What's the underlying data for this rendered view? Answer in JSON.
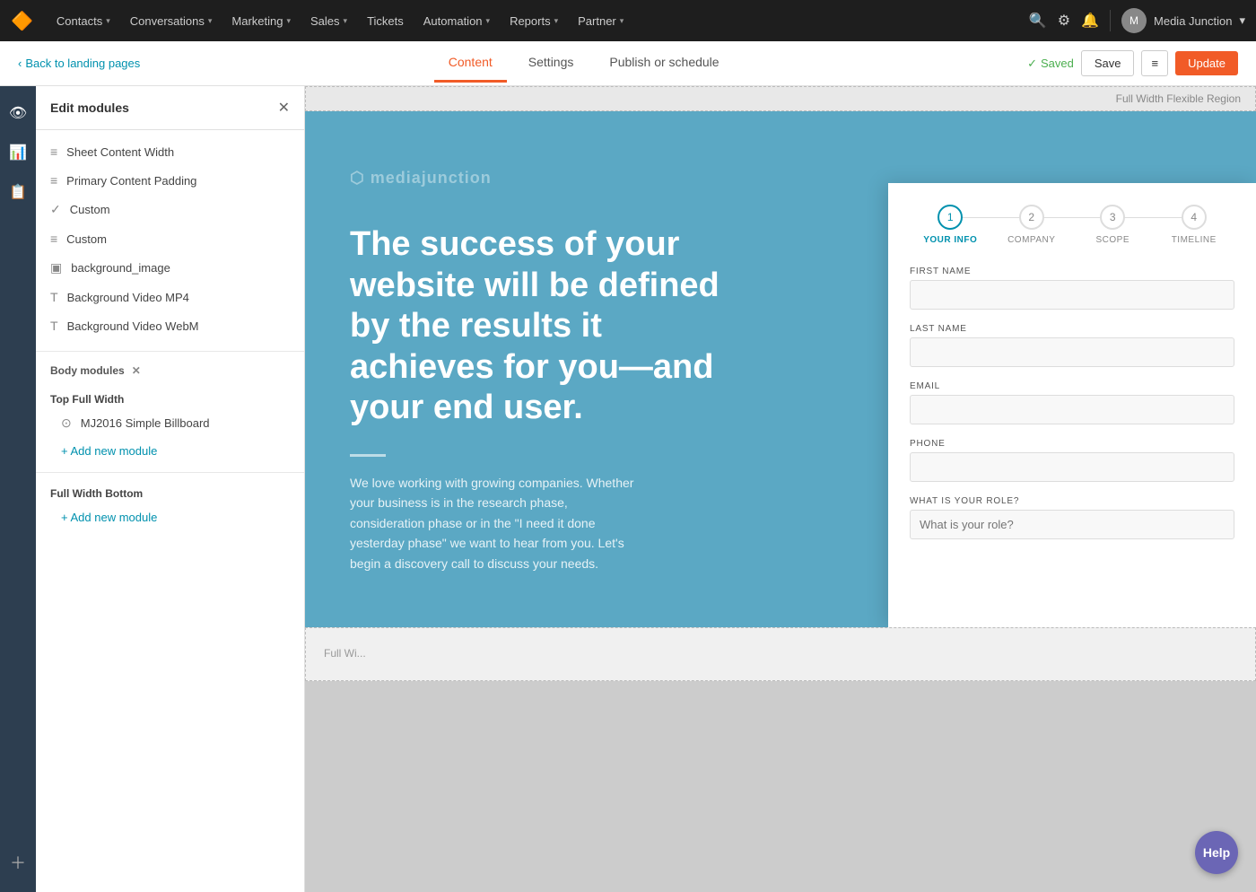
{
  "topnav": {
    "logo": "🔶",
    "items": [
      {
        "label": "Contacts",
        "hasDropdown": true
      },
      {
        "label": "Conversations",
        "hasDropdown": true
      },
      {
        "label": "Marketing",
        "hasDropdown": true
      },
      {
        "label": "Sales",
        "hasDropdown": true
      },
      {
        "label": "Tickets",
        "hasDropdown": false
      },
      {
        "label": "Automation",
        "hasDropdown": true
      },
      {
        "label": "Reports",
        "hasDropdown": true
      },
      {
        "label": "Partner",
        "hasDropdown": true
      }
    ],
    "userName": "Media Junction",
    "userInitial": "M"
  },
  "subheader": {
    "backLabel": "Back to landing pages",
    "tabs": [
      {
        "label": "Content",
        "active": true
      },
      {
        "label": "Settings",
        "active": false
      },
      {
        "label": "Publish or schedule",
        "active": false
      }
    ],
    "savedLabel": "Saved",
    "saveBtn": "Save",
    "updateBtn": "Update"
  },
  "modulePanel": {
    "title": "Edit modules",
    "modules": [
      {
        "icon": "≡",
        "label": "Sheet Content Width"
      },
      {
        "icon": "≡",
        "label": "Primary Content Padding"
      },
      {
        "icon": "✓",
        "label": "Custom"
      },
      {
        "icon": "≡",
        "label": "Custom"
      },
      {
        "icon": "▣",
        "label": "background_image"
      },
      {
        "icon": "T",
        "label": "Background Video MP4"
      },
      {
        "icon": "T",
        "label": "Background Video WebM"
      }
    ],
    "bodyModulesLabel": "Body modules",
    "topFullWidthLabel": "Top Full Width",
    "submodules": [
      {
        "icon": "⊙",
        "label": "MJ2016 Simple Billboard"
      }
    ],
    "addNewModuleLabel": "+ Add new module",
    "fullWidthBottomLabel": "Full Width Bottom",
    "addNewModuleBottom": "+ Add new module"
  },
  "preview": {
    "regionLabel": "Full Width Flexible Region",
    "logoText": "mediajunction",
    "heroTitle": "The success of your website will be defined by the results it achieves for you—and your end user.",
    "heroBody": "We love working with growing companies. Whether your business is in the research phase, consideration phase or in the \"I need it done yesterday phase\" we want to hear from you. Let's begin a discovery call to discuss your needs.",
    "bottomRegionLabel": "Full Wi..."
  },
  "form": {
    "steps": [
      {
        "number": "1",
        "label": "YOUR INFO",
        "active": true
      },
      {
        "number": "2",
        "label": "COMPANY",
        "active": false
      },
      {
        "number": "3",
        "label": "SCOPE",
        "active": false
      },
      {
        "number": "4",
        "label": "TIMELINE",
        "active": false
      }
    ],
    "fields": [
      {
        "label": "FIRST NAME",
        "type": "text",
        "value": ""
      },
      {
        "label": "LAST NAME",
        "type": "text",
        "value": ""
      },
      {
        "label": "EMAIL",
        "type": "email",
        "value": ""
      },
      {
        "label": "PHONE",
        "type": "tel",
        "value": ""
      },
      {
        "label": "WHAT IS YOUR ROLE?",
        "type": "text",
        "placeholder": "What is your role?",
        "value": ""
      }
    ]
  },
  "help": {
    "label": "Help"
  }
}
